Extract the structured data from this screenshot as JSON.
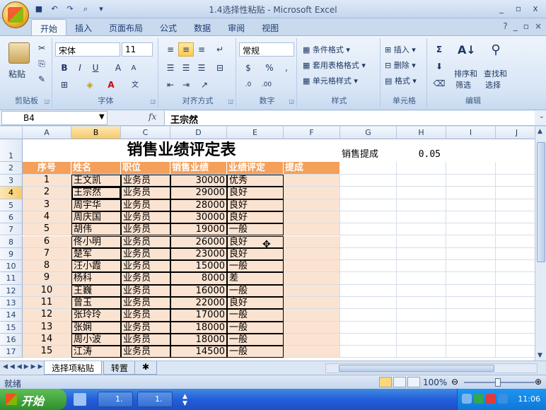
{
  "window": {
    "title": "1.4选择性粘贴 - Microsoft Excel",
    "controls": [
      "_",
      "▫",
      "x"
    ]
  },
  "qat": [
    "save-icon",
    "undo-icon",
    "redo-icon",
    "print-preview-icon"
  ],
  "tabs": [
    "开始",
    "插入",
    "页面布局",
    "公式",
    "数据",
    "审阅",
    "视图"
  ],
  "ribbon": {
    "clipboard": {
      "paste": "粘贴",
      "label": "剪贴板"
    },
    "font": {
      "name": "宋体",
      "size": "11",
      "label": "字体"
    },
    "alignment": {
      "label": "对齐方式"
    },
    "number": {
      "format": "常规",
      "label": "数字"
    },
    "styles": {
      "conditional": "条件格式",
      "table": "套用表格格式",
      "cell_styles": "单元格样式",
      "label": "样式"
    },
    "cells": {
      "insert": "插入",
      "delete": "删除",
      "format": "格式",
      "label": "单元格"
    },
    "editing": {
      "sort_filter_1": "排序和",
      "sort_filter_2": "筛选",
      "find_select_1": "查找和",
      "find_select_2": "选择",
      "label": "编辑"
    }
  },
  "formula_bar": {
    "name_box": "B4",
    "fx": "fx",
    "content": "王宗然"
  },
  "columns": [
    "A",
    "B",
    "C",
    "D",
    "E",
    "F",
    "G",
    "H",
    "I",
    "J"
  ],
  "rows": [
    "1",
    "2",
    "3",
    "4",
    "5",
    "6",
    "7",
    "8",
    "9",
    "10",
    "11",
    "12",
    "13",
    "14",
    "15",
    "16",
    "17"
  ],
  "sheet": {
    "title": "销售业绩评定表",
    "commission_label": "销售提成",
    "commission_value": "0.05",
    "headers": [
      "序号",
      "姓名",
      "职位",
      "销售业绩",
      "业绩评定",
      "提成"
    ],
    "records": [
      [
        "1",
        "王文凯",
        "业务员",
        "30000",
        "优秀",
        ""
      ],
      [
        "2",
        "王宗然",
        "业务员",
        "29000",
        "良好",
        ""
      ],
      [
        "3",
        "周宇华",
        "业务员",
        "28000",
        "良好",
        ""
      ],
      [
        "4",
        "周庆国",
        "业务员",
        "30000",
        "良好",
        ""
      ],
      [
        "5",
        "胡伟",
        "业务员",
        "19000",
        "一般",
        ""
      ],
      [
        "6",
        "佟小明",
        "业务员",
        "26000",
        "良好",
        ""
      ],
      [
        "7",
        "楚军",
        "业务员",
        "23000",
        "良好",
        ""
      ],
      [
        "8",
        "汪小霞",
        "业务员",
        "15000",
        "一般",
        ""
      ],
      [
        "9",
        "杨科",
        "业务员",
        "8000",
        "差",
        ""
      ],
      [
        "10",
        "王巍",
        "业务员",
        "16000",
        "一般",
        ""
      ],
      [
        "11",
        "曾玉",
        "业务员",
        "22000",
        "良好",
        ""
      ],
      [
        "12",
        "张玲玲",
        "业务员",
        "17000",
        "一般",
        ""
      ],
      [
        "13",
        "张娴",
        "业务员",
        "18000",
        "一般",
        ""
      ],
      [
        "14",
        "周小波",
        "业务员",
        "18000",
        "一般",
        ""
      ],
      [
        "15",
        "江涛",
        "业务员",
        "14500",
        "一般",
        ""
      ]
    ]
  },
  "sheet_tabs": [
    "选择项粘贴",
    "转置"
  ],
  "status": {
    "ready": "就绪",
    "zoom": "100%"
  },
  "taskbar": {
    "start": "开始",
    "tasks": [
      "1.",
      "1."
    ],
    "clock": "11:06"
  }
}
